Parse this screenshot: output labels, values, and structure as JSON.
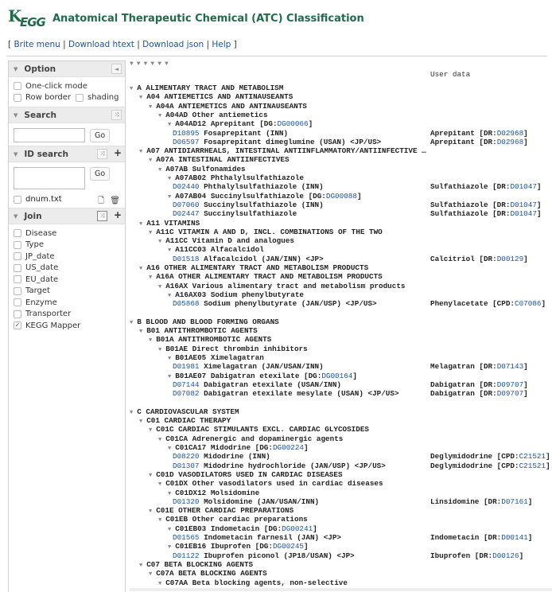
{
  "header": {
    "logo_k": "K",
    "logo_gg": "EGG",
    "title": "Anatomical Therapeutic Chemical (ATC) Classification"
  },
  "menu": {
    "open": "[ ",
    "sep": " | ",
    "close": " ]",
    "items": [
      "Brite menu",
      "Download htext",
      "Download json",
      "Help"
    ]
  },
  "sidebar": {
    "option": {
      "title": "Option",
      "one_click": "One-click mode",
      "row_border": "Row border",
      "shading": "shading"
    },
    "search": {
      "title": "Search",
      "value": "",
      "go": "Go"
    },
    "id_search": {
      "title": "ID search",
      "value": "",
      "go": "Go",
      "file": "dnum.txt"
    },
    "join": {
      "title": "Join",
      "items": [
        {
          "label": "Disease",
          "checked": false
        },
        {
          "label": "Type",
          "checked": false
        },
        {
          "label": "JP_date",
          "checked": false
        },
        {
          "label": "US_date",
          "checked": false
        },
        {
          "label": "EU_date",
          "checked": false
        },
        {
          "label": "Target",
          "checked": false
        },
        {
          "label": "Enzyme",
          "checked": false
        },
        {
          "label": "Transporter",
          "checked": false
        },
        {
          "label": "KEGG Mapper",
          "checked": true
        }
      ]
    }
  },
  "tree": {
    "level_toggles": "▼▼▼▼▼▼",
    "user_data_header": "User data",
    "rows": [
      {
        "indent": 0,
        "expand": true,
        "text": "A ALIMENTARY TRACT AND METABOLISM"
      },
      {
        "indent": 1,
        "expand": true,
        "text": "A04 ANTIEMETICS AND ANTINAUSEANTS"
      },
      {
        "indent": 2,
        "expand": true,
        "text": "A04A ANTIEMETICS AND ANTINAUSEANTS"
      },
      {
        "indent": 3,
        "expand": true,
        "text": "A04AD Other antiemetics"
      },
      {
        "indent": 4,
        "expand": true,
        "text": "A04AD12 Aprepitant [DG:",
        "link": "DG00066",
        "suffix": "]"
      },
      {
        "indent": 5,
        "drug": "D10895",
        "text": " Fosaprepitant (INN)",
        "ud": "Aprepitant [DR:",
        "ud_link": "D02968",
        "ud_suffix": "]"
      },
      {
        "indent": 5,
        "drug": "D06597",
        "text": " Fosaprepitant dimeglumine (USAN) <JP/US>",
        "ud": "Aprepitant [DR:",
        "ud_link": "D02968",
        "ud_suffix": "]"
      },
      {
        "indent": 1,
        "expand": true,
        "text": "A07 ANTIDIARRHEALS, INTESTINAL ANTIINFLAMMATORY/ANTIINFECTIVE …"
      },
      {
        "indent": 2,
        "expand": true,
        "text": "A07A INTESTINAL ANTIINFECTIVES"
      },
      {
        "indent": 3,
        "expand": true,
        "text": "A07AB Sulfonamides"
      },
      {
        "indent": 4,
        "expand": true,
        "text": "A07AB02 Phthalylsulfathiazole"
      },
      {
        "indent": 5,
        "drug": "D02440",
        "text": " Phthalylsulfathiazole (INN)",
        "ud": "Sulfathiazole [DR:",
        "ud_link": "D01047",
        "ud_suffix": "]"
      },
      {
        "indent": 4,
        "expand": true,
        "text": "A07AB04 Succinylsulfathiazole [DG:",
        "link": "DG00088",
        "suffix": "]"
      },
      {
        "indent": 5,
        "drug": "D07060",
        "text": " Succinylsulfathiazole (INN)",
        "ud": "Sulfathiazole [DR:",
        "ud_link": "D01047",
        "ud_suffix": "]"
      },
      {
        "indent": 5,
        "drug": "D02447",
        "text": " Succinylsulfathiazole",
        "ud": "Sulfathiazole [DR:",
        "ud_link": "D01047",
        "ud_suffix": "]"
      },
      {
        "indent": 1,
        "expand": true,
        "text": "A11 VITAMINS"
      },
      {
        "indent": 2,
        "expand": true,
        "text": "A11C VITAMIN A AND D, INCL. COMBINATIONS OF THE TWO"
      },
      {
        "indent": 3,
        "expand": true,
        "text": "A11CC Vitamin D and analogues"
      },
      {
        "indent": 4,
        "expand": true,
        "text": "A11CC03 Alfacalcidol"
      },
      {
        "indent": 5,
        "drug": "D01518",
        "text": " Alfacalcidol (JAN/INN) <JP>",
        "ud": "Calcitriol [DR:",
        "ud_link": "D00129",
        "ud_suffix": "]"
      },
      {
        "indent": 1,
        "expand": true,
        "text": "A16 OTHER ALIMENTARY TRACT AND METABOLISM PRODUCTS"
      },
      {
        "indent": 2,
        "expand": true,
        "text": "A16A OTHER ALIMENTARY TRACT AND METABOLISM PRODUCTS"
      },
      {
        "indent": 3,
        "expand": true,
        "text": "A16AX Various alimentary tract and metabolism products"
      },
      {
        "indent": 4,
        "expand": true,
        "text": "A16AX03 Sodium phenylbutyrate"
      },
      {
        "indent": 5,
        "drug": "D05868",
        "text": " Sodium phenylbutyrate (JAN/USP) <JP/US>",
        "ud": "Phenylacetate [CPD:",
        "ud_link": "C07086",
        "ud_suffix": "]"
      },
      {
        "blank": true
      },
      {
        "indent": 0,
        "expand": true,
        "text": "B BLOOD AND BLOOD FORMING ORGANS"
      },
      {
        "indent": 1,
        "expand": true,
        "text": "B01 ANTITHROMBOTIC AGENTS"
      },
      {
        "indent": 2,
        "expand": true,
        "text": "B01A ANTITHROMBOTIC AGENTS"
      },
      {
        "indent": 3,
        "expand": true,
        "text": "B01AE Direct thrombin inhibitors"
      },
      {
        "indent": 4,
        "expand": true,
        "text": "B01AE05 Ximelagatran"
      },
      {
        "indent": 5,
        "drug": "D01981",
        "text": " Ximelagatran (JAN/USAN/INN)",
        "ud": "Melagatran [DR:",
        "ud_link": "D07143",
        "ud_suffix": "]"
      },
      {
        "indent": 4,
        "expand": true,
        "text": "B01AE07 Dabigatran etexilate [DG:",
        "link": "DG00164",
        "suffix": "]"
      },
      {
        "indent": 5,
        "drug": "D07144",
        "text": " Dabigatran etexilate (USAN/INN)",
        "ud": "Dabigatran [DR:",
        "ud_link": "D09707",
        "ud_suffix": "]"
      },
      {
        "indent": 5,
        "drug": "D07082",
        "text": " Dabigatran etexilate mesylate (USAN) <JP/US>",
        "ud": "Dabigatran [DR:",
        "ud_link": "D09707",
        "ud_suffix": "]"
      },
      {
        "blank": true
      },
      {
        "indent": 0,
        "expand": true,
        "text": "C CARDIOVASCULAR SYSTEM"
      },
      {
        "indent": 1,
        "expand": true,
        "text": "C01 CARDIAC THERAPY"
      },
      {
        "indent": 2,
        "expand": true,
        "text": "C01C CARDIAC STIMULANTS EXCL. CARDIAC GLYCOSIDES"
      },
      {
        "indent": 3,
        "expand": true,
        "text": "C01CA Adrenergic and dopaminergic agents"
      },
      {
        "indent": 4,
        "expand": true,
        "text": "C01CA17 Midodrine [DG:",
        "link": "DG00224",
        "suffix": "]"
      },
      {
        "indent": 5,
        "drug": "D08220",
        "text": " Midodrine (INN)",
        "ud": "Deglymidodrine [CPD:",
        "ud_link": "C21521",
        "ud_suffix": "]"
      },
      {
        "indent": 5,
        "drug": "D01307",
        "text": " Midodrine hydrochloride (JAN/USP) <JP/US>",
        "ud": "Deglymidodrine [CPD:",
        "ud_link": "C21521",
        "ud_suffix": "]"
      },
      {
        "indent": 2,
        "expand": true,
        "text": "C01D VASODILATORS USED IN CARDIAC DISEASES"
      },
      {
        "indent": 3,
        "expand": true,
        "text": "C01DX Other vasodilators used in cardiac diseases"
      },
      {
        "indent": 4,
        "expand": true,
        "text": "C01DX12 Molsidomine"
      },
      {
        "indent": 5,
        "drug": "D01320",
        "text": " Molsidomine (JAN/USAN/INN)",
        "ud": "Linsidomine [DR:",
        "ud_link": "D07161",
        "ud_suffix": "]"
      },
      {
        "indent": 2,
        "expand": true,
        "text": "C01E OTHER CARDIAC PREPARATIONS"
      },
      {
        "indent": 3,
        "expand": true,
        "text": "C01EB Other cardiac preparations"
      },
      {
        "indent": 4,
        "expand": true,
        "text": "C01EB03 Indometacin [DG:",
        "link": "DG00241",
        "suffix": "]"
      },
      {
        "indent": 5,
        "drug": "D01565",
        "text": " Indometacin farnesil (JAN) <JP>",
        "ud": "Indometacin [DR:",
        "ud_link": "D00141",
        "ud_suffix": "]"
      },
      {
        "indent": 4,
        "expand": true,
        "text": "C01EB16 Ibuprofen [DG:",
        "link": "DG00245",
        "suffix": "]"
      },
      {
        "indent": 5,
        "drug": "D01122",
        "text": " Ibuprofen piconol (JP18/USAN) <JP>",
        "ud": "Ibuprofen [DR:",
        "ud_link": "D00126",
        "ud_suffix": "]"
      },
      {
        "indent": 1,
        "expand": true,
        "text": "C07 BETA BLOCKING AGENTS"
      },
      {
        "indent": 2,
        "expand": true,
        "text": "C07A BETA BLOCKING AGENTS"
      },
      {
        "indent": 3,
        "expand": true,
        "text": "C07AA Beta blocking agents, non-selective"
      }
    ]
  },
  "icons": {
    "collapse": "◄",
    "toggle": "▼",
    "shuffle": "⤨",
    "plus": "+",
    "file": "🗋",
    "trash": "🗑",
    "check": "✓"
  }
}
